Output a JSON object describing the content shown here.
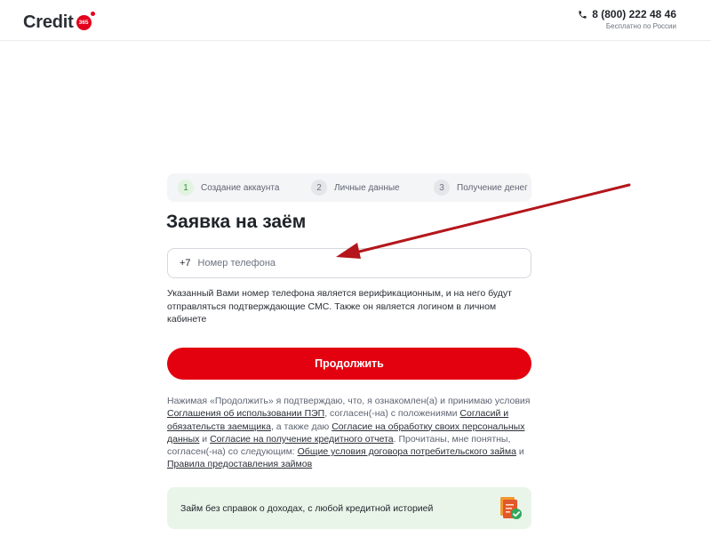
{
  "header": {
    "logo_text": "Credit",
    "logo_badge": "365",
    "phone_number": "8 (800) 222 48 46",
    "phone_note": "Бесплатно по России"
  },
  "steps": [
    {
      "num": "1",
      "label": "Создание аккаунта",
      "active": true
    },
    {
      "num": "2",
      "label": "Личные данные",
      "active": false
    },
    {
      "num": "3",
      "label": "Получение денег",
      "active": false
    }
  ],
  "form": {
    "title": "Заявка на заём",
    "phone_prefix": "+7",
    "phone_value": "",
    "phone_placeholder": "Номер телефона",
    "hint": "Указанный Вами номер телефона является верификационным, и на него будут отправляться подтверждающие СМС. Также он является логином в личном кабинете",
    "continue_label": "Продолжить"
  },
  "consent": {
    "t1": "Нажимая «Продолжить» я подтверждаю, что, я ознакомлен(а) и принимаю условия ",
    "link_pep": "Соглашения об использовании ПЭП",
    "t2": ", согласен(-на) с положениями ",
    "link_obligations": "Согласий и обязательств заемщика",
    "t3": ", а также даю ",
    "link_personal_data": "Согласие на обработку своих персональных данных",
    "t4": " и ",
    "link_credit_report": "Согласие на получение кредитного отчета",
    "t5": ". Прочитаны, мне понятны, согласен(-на) со следующим: ",
    "link_general_terms": "Общие условия договора потребительского займа",
    "t6": " и ",
    "link_rules": "Правила предоставления займов"
  },
  "promo": {
    "text": "Займ без справок о доходах, с любой кредитной историей",
    "icon": "document-check-icon"
  },
  "colors": {
    "brand_red": "#e3000f",
    "annotation_arrow": "#b4161b",
    "step_active": "#3a8f3b",
    "promo_bg": "#eaf5ea"
  }
}
